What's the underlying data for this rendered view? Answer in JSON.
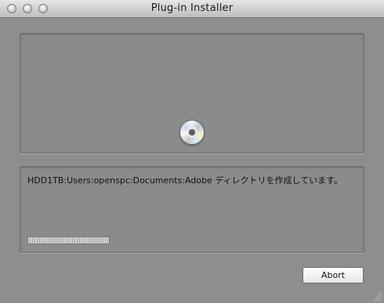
{
  "window": {
    "title": "Plug-in Installer"
  },
  "panels": {
    "top": {
      "icon": "cd-icon"
    },
    "bottom": {
      "status_text": "HDD1TB:Users:openspc:Documents:Adobe ディレクトリを作成しています。",
      "progress": {
        "indeterminate": true
      }
    }
  },
  "buttons": {
    "abort_label": "Abort"
  }
}
